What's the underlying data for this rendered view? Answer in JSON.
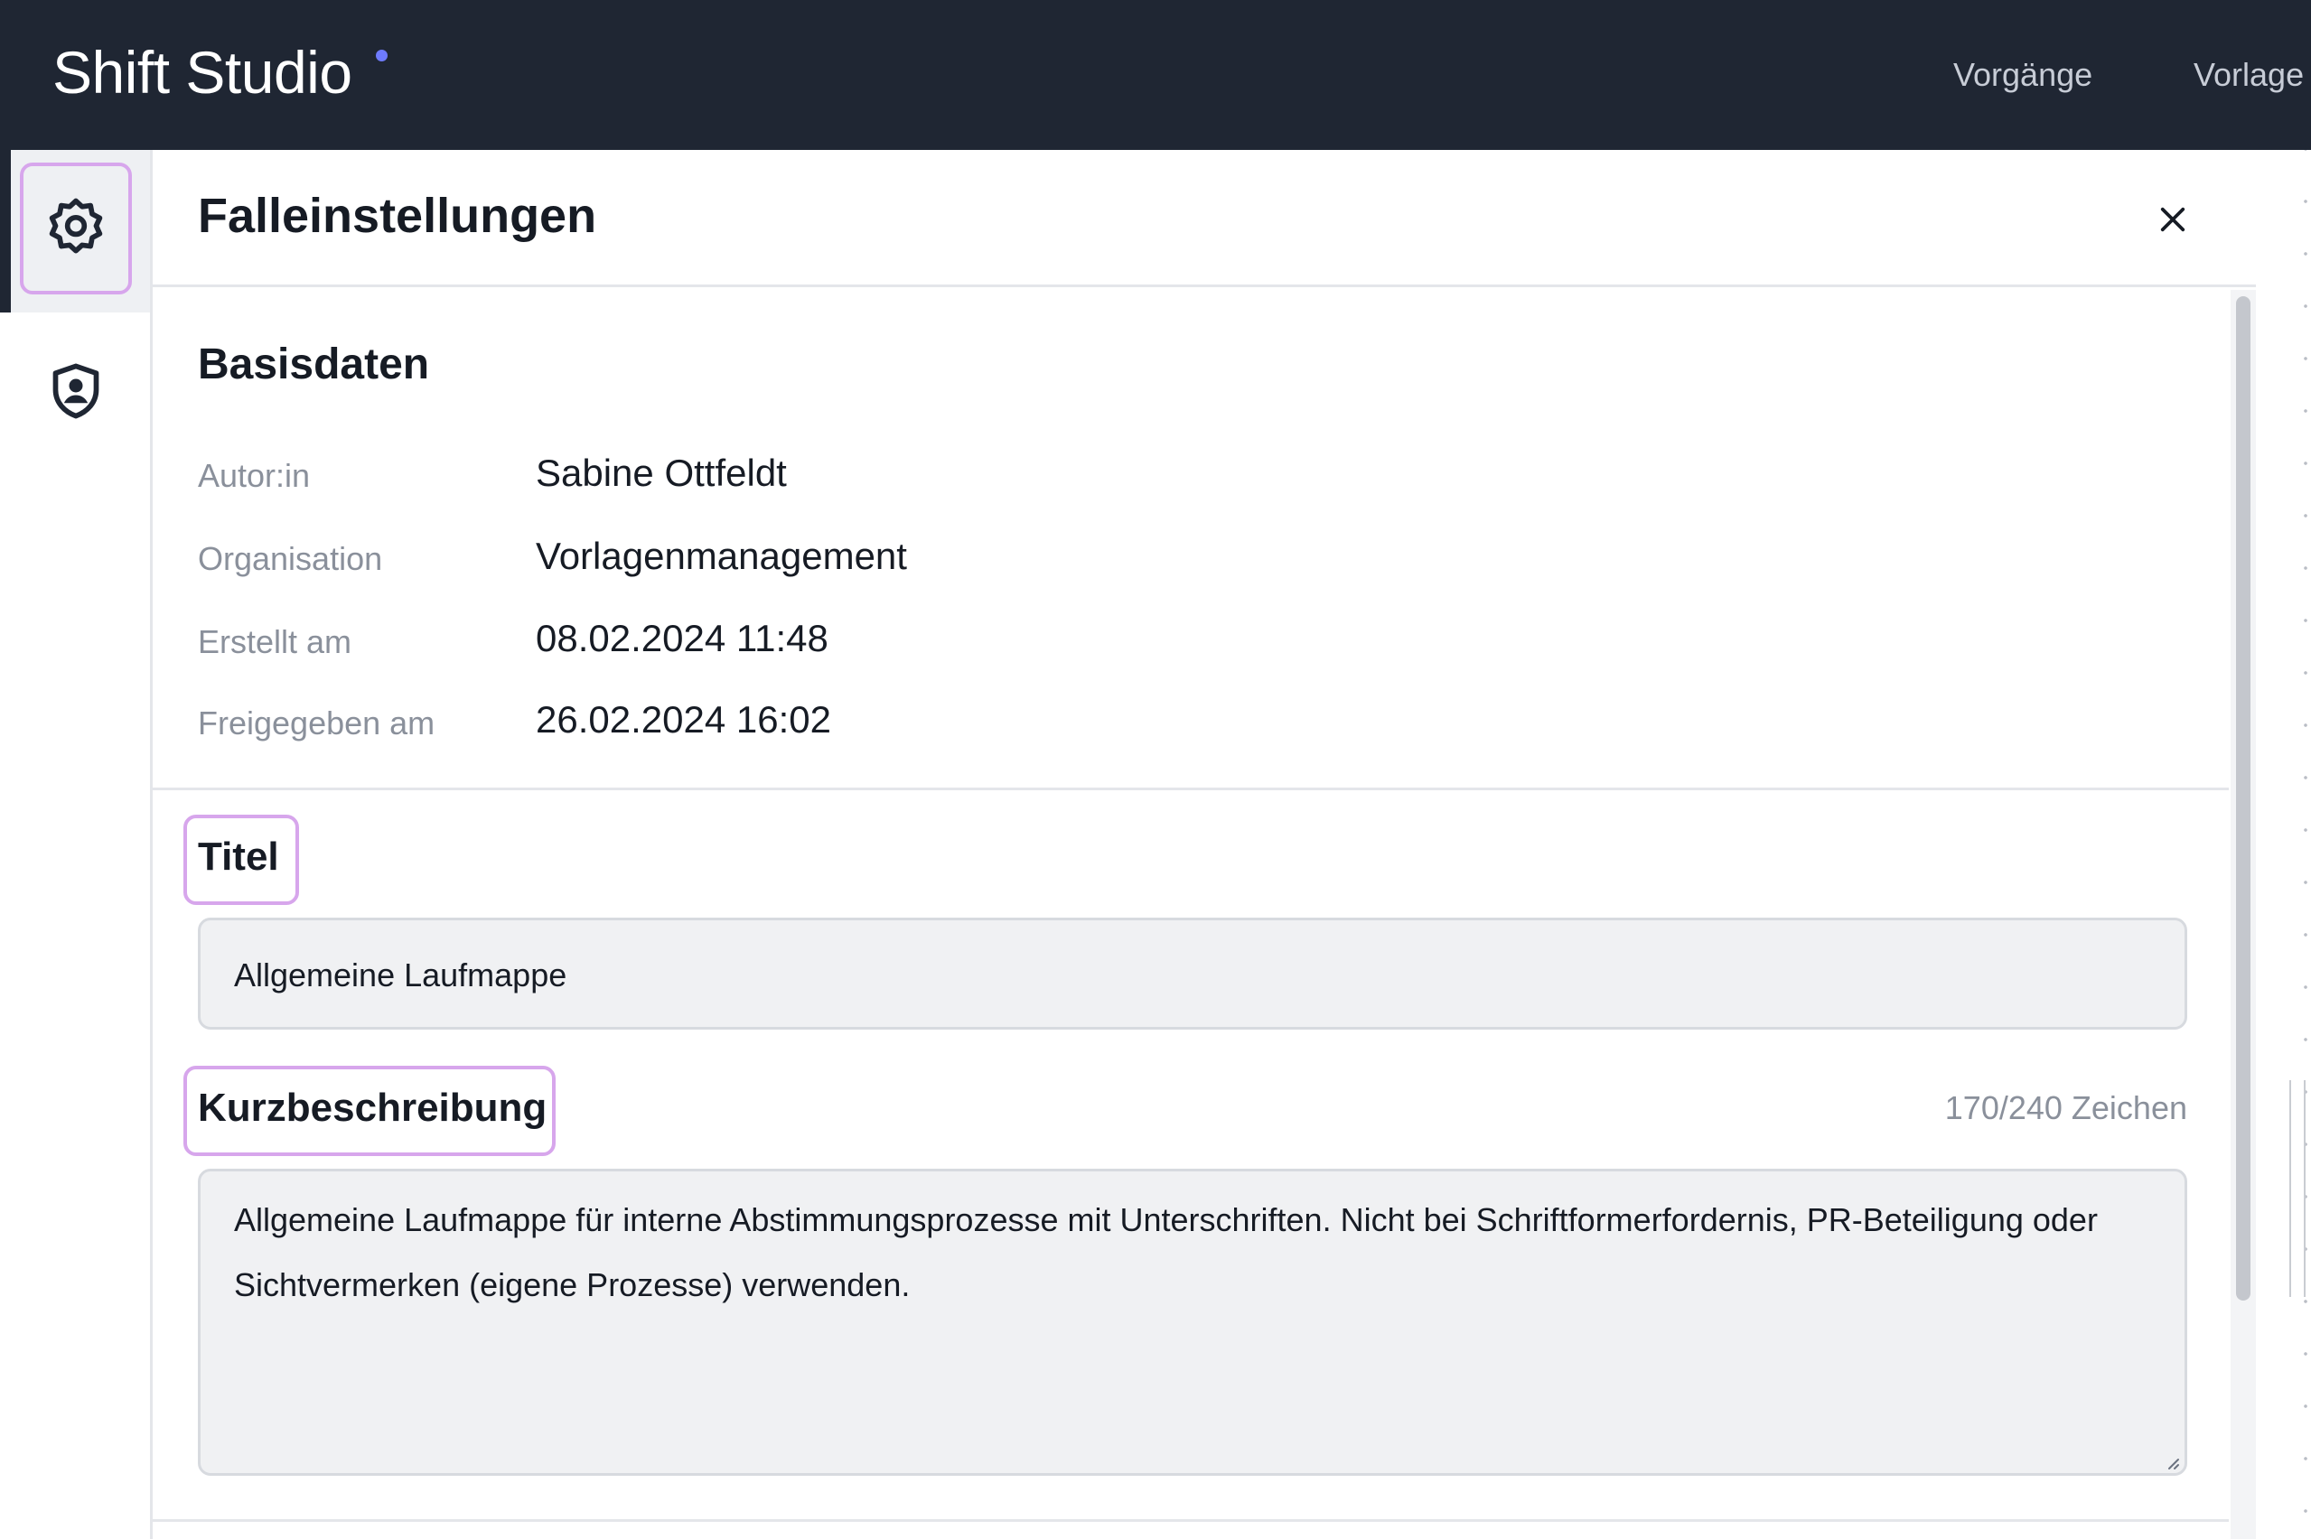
{
  "topbar": {
    "brand": "Shift Studio",
    "nav": [
      "Vorgänge",
      "Vorlage"
    ]
  },
  "rail": {
    "items": [
      {
        "icon": "settings-gear-icon",
        "active": true
      },
      {
        "icon": "shield-person-icon",
        "active": false
      }
    ]
  },
  "panel": {
    "title": "Falleinstellungen",
    "close_icon": "close-icon",
    "basis": {
      "title": "Basisdaten",
      "rows": [
        {
          "label": "Autor:in",
          "value": "Sabine Ottfeldt"
        },
        {
          "label": "Organisation",
          "value": "Vorlagenmanagement"
        },
        {
          "label": "Erstellt am",
          "value": "08.02.2024 11:48"
        },
        {
          "label": "Freigegeben am",
          "value": "26.02.2024 16:02"
        }
      ]
    },
    "titel": {
      "label": "Titel",
      "value": "Allgemeine Laufmappe"
    },
    "kurzbeschreibung": {
      "label": "Kurzbeschreibung",
      "counter": "170/240 Zeichen",
      "value": "Allgemeine Laufmappe für interne Abstimmungsprozesse mit Unterschriften. Nicht bei Schriftformerfordernis, PR-Beteiligung oder Sichtvermerken (eigene Prozesse) verwenden."
    }
  },
  "colors": {
    "topbar_bg": "#1f2633",
    "brand_dot": "#6e7bff",
    "highlight_outline": "#d7a6ec",
    "input_bg": "#f0f1f3",
    "muted_text": "#8a909b"
  }
}
